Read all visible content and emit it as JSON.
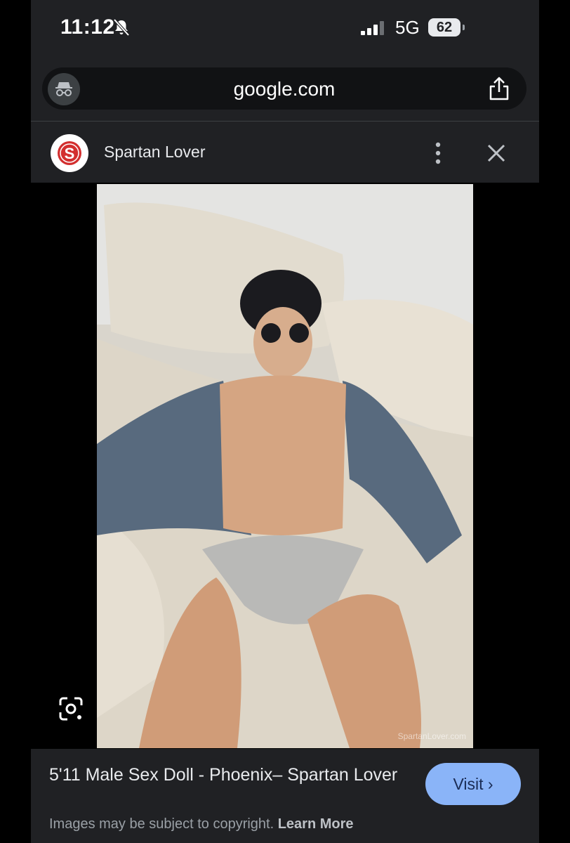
{
  "status_bar": {
    "time": "11:12",
    "network": "5G",
    "battery": "62"
  },
  "browser": {
    "url": "google.com",
    "icons": [
      "incognito-icon",
      "share-icon"
    ]
  },
  "source": {
    "name": "Spartan Lover",
    "favicon_letter": "S",
    "favicon_color": "#d32f2f"
  },
  "image": {
    "watermark": "SpartanLover.com"
  },
  "result": {
    "title": "5'11 Male Sex Doll - Phoenix– Spartan Lover",
    "visit_label": "Visit",
    "copyright_text": "Images may be subject to copyright.",
    "learn_more": "Learn More"
  },
  "colors": {
    "background": "#000000",
    "panel": "#202124",
    "accent": "#8ab4f8"
  }
}
